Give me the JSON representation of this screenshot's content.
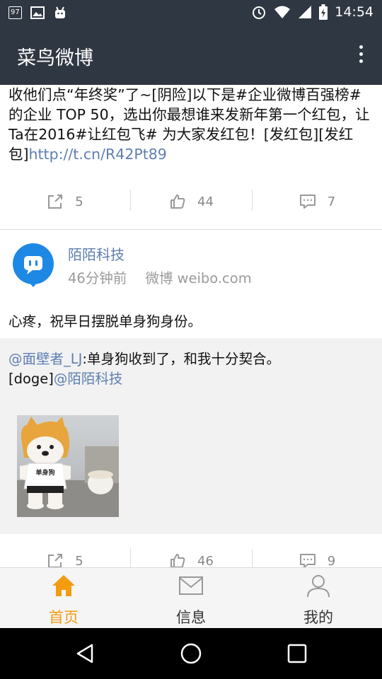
{
  "status_bar": {
    "badge": "97",
    "time": "14:54"
  },
  "app_bar": {
    "title": "菜鸟微博",
    "menu_icon": "overflow-menu-icon"
  },
  "post": {
    "text_parts": [
      "收他们点“年终奖”了~[阴险]以下是#企业微博百强榜#的企业 TOP 50，选出你最想谁来发新年第一个红包，让Ta在2016#让红包飞# 为大家发红包！[发红包][发红包]",
      "http://t.cn/R42Pt89"
    ],
    "actions": {
      "repost_count": "5",
      "like_count": "44",
      "comment_count": "7"
    }
  },
  "post2": {
    "author": "陌陌科技",
    "time_ago": "46分钟前",
    "source": "微博 weibo.com",
    "comment": "心疼，祝早日摆脱单身狗身份。",
    "repost": {
      "mention_author": "@面壁者_LJ",
      "text": ":单身狗收到了，和我十分契合。",
      "line2_prefix": "[doge]",
      "mention_tail": "@陌陌科技"
    },
    "image_label": "单身狗",
    "actions": {
      "repost_count": "5",
      "like_count": "46",
      "comment_count": "9"
    }
  },
  "bottom_nav": {
    "items": [
      {
        "label": "首页",
        "icon": "home-icon",
        "active": true
      },
      {
        "label": "信息",
        "icon": "mail-icon",
        "active": false
      },
      {
        "label": "我的",
        "icon": "profile-icon",
        "active": false
      }
    ],
    "active_color": "#f39c12"
  },
  "colors": {
    "header_bg": "#2f3742",
    "link": "#5d7fb2"
  }
}
